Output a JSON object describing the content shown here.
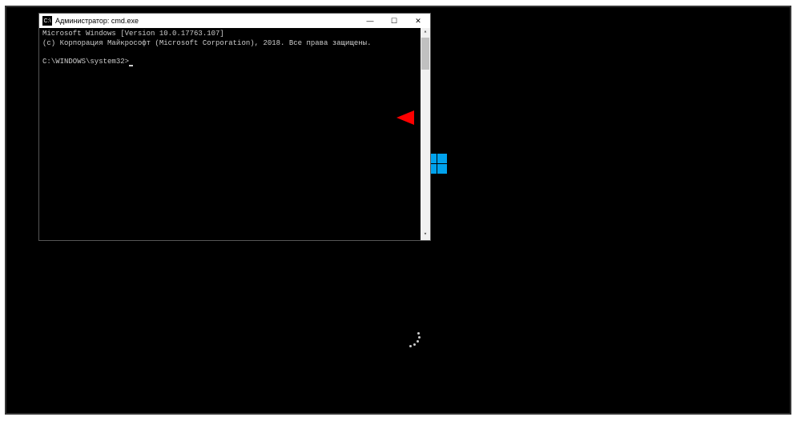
{
  "desktop": {
    "windows_logo_color": "#00a2ed"
  },
  "cmd": {
    "title": "Администратор: cmd.exe",
    "lines": {
      "version": "Microsoft Windows [Version 10.0.17763.107]",
      "copyright": "(c) Корпорация Майкрософт (Microsoft Corporation), 2018. Все права защищены.",
      "prompt": "C:\\WINDOWS\\system32>"
    },
    "controls": {
      "minimize": "—",
      "maximize": "☐",
      "close": "✕"
    }
  },
  "annotation": {
    "arrow_color": "#e00000"
  }
}
